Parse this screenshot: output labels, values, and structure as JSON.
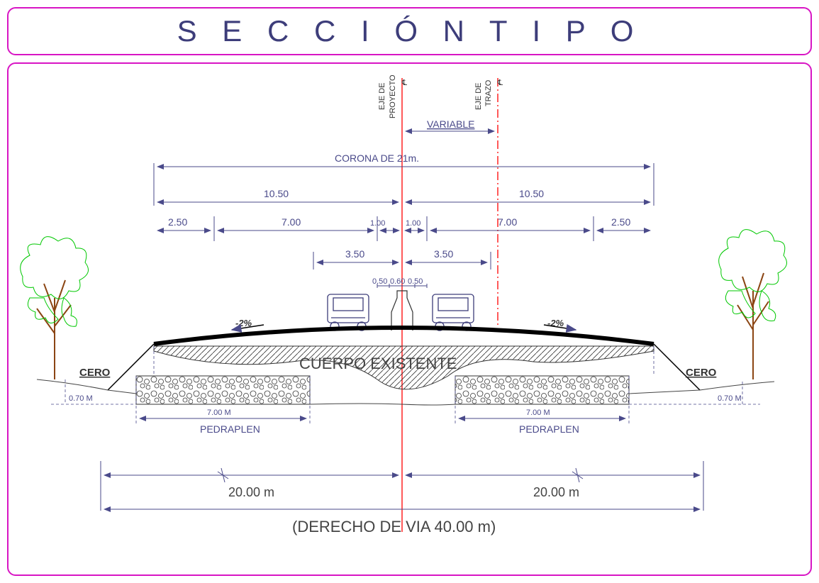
{
  "title": "S E C C I Ó N  T I P O",
  "axis": {
    "proyecto": "EJE DE\nPROYECTO",
    "trazo": "EJE DE\nTRAZO",
    "variable": "VARIABLE"
  },
  "dims": {
    "corona": "CORONA DE 21m.",
    "half": "10.50",
    "shoulder": "2.50",
    "lane": "7.00",
    "inner": "1.00",
    "innerL": "1.00",
    "laneHalf": "3.50",
    "barrier1": "0.50",
    "barrier2": "0.60",
    "barrier3": "0.50"
  },
  "slope": "-2%",
  "bodies": {
    "cuerpo": "CUERPO EXISTENTE",
    "cero": "CERO",
    "depth": "0.70 M",
    "pedra_dim": "7.00 M",
    "pedra": "PEDRAPLEN"
  },
  "bottom": {
    "half": "20.00 m",
    "total": "(DERECHO DE VIA 40.00 m)"
  }
}
